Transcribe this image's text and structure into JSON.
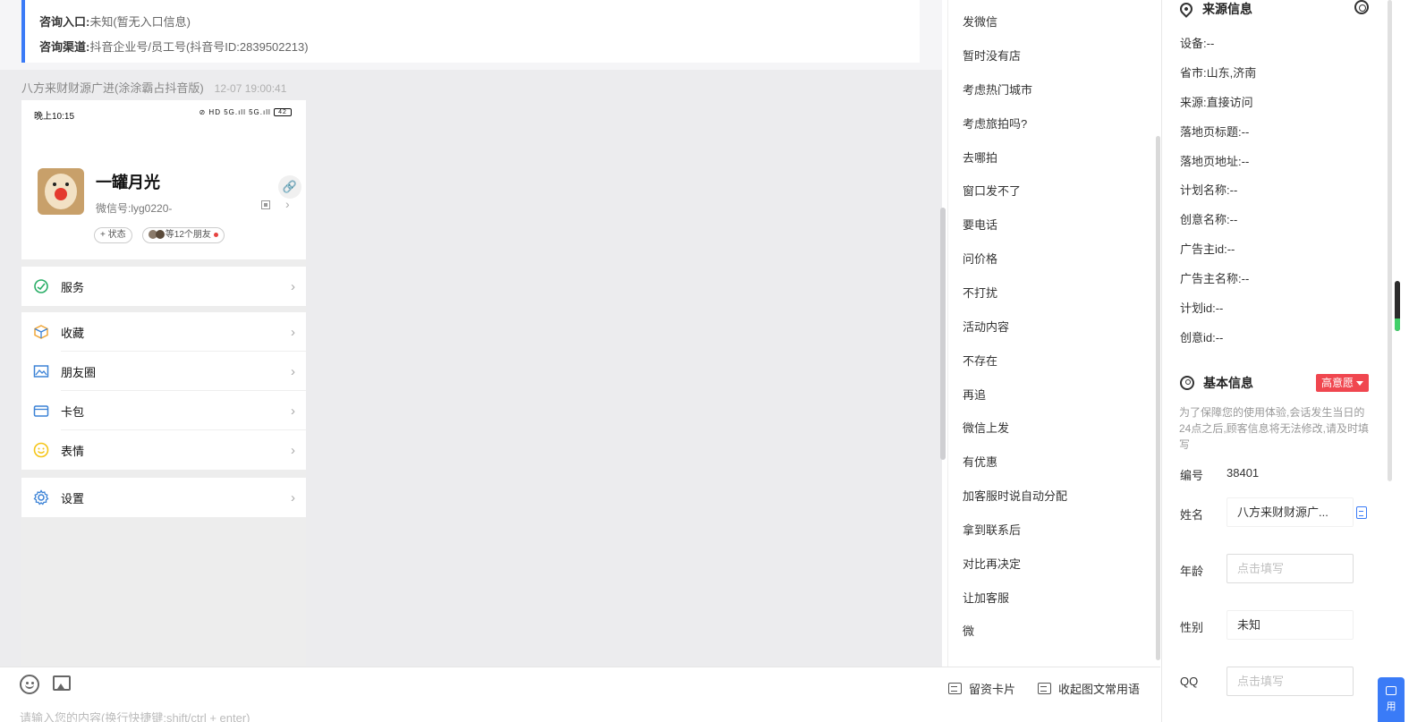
{
  "consult": {
    "entry_label": "咨询入口:",
    "entry_value": "未知(暂无入口信息)",
    "channel_label": "咨询渠道:",
    "channel_value": "抖音企业号/员工号(抖音号ID:2839502213)"
  },
  "message": {
    "sender": "八方来财财源广进(涂涂霸占抖音版)",
    "time": "12-07 19:00:41"
  },
  "phone_shot": {
    "status_time": "晚上10:15",
    "status_icons": "⊘ HD 5G.ıll 5G.ıll",
    "battery": "42",
    "nickname": "一罐月光",
    "wechat_id": "微信号:lyg0220-",
    "status_pill": "+ 状态",
    "friends_pill": "等12个朋友",
    "menu": [
      {
        "label": "服务",
        "icon": "service-icon",
        "color": "#2aae67"
      },
      {
        "label": "收藏",
        "icon": "cube-icon",
        "color": "#f0a73a"
      },
      {
        "label": "朋友圈",
        "icon": "moments-icon",
        "color": "#3b82d6"
      },
      {
        "label": "卡包",
        "icon": "card-icon",
        "color": "#3b82d6"
      },
      {
        "label": "表情",
        "icon": "emoji-icon",
        "color": "#f5c518"
      },
      {
        "label": "设置",
        "icon": "settings-icon",
        "color": "#3b82d6"
      }
    ]
  },
  "phrases": [
    "发微信",
    "暂时没有店",
    "考虑热门城市",
    "考虑旅拍吗?",
    "去哪拍",
    "窗口发不了",
    "要电话",
    "问价格",
    "不打扰",
    "活动内容",
    "不存在",
    "再追",
    "微信上发",
    "有优惠",
    "加客服时说自动分配",
    "拿到联系后",
    "对比再决定",
    "让加客服",
    "微"
  ],
  "input_bar": {
    "card_button": "留资卡片",
    "collapse_button": "收起图文常用语",
    "placeholder": "请输入您的内容(换行快捷键:shift/ctrl + enter)"
  },
  "source_info": {
    "title": "来源信息",
    "rows": [
      "设备:--",
      "省市:山东,济南",
      "来源:直接访问",
      "落地页标题:--",
      "落地页地址:--",
      "计划名称:--",
      "创意名称:--",
      "广告主id:--",
      "广告主名称:--",
      "计划id:--",
      "创意id:--"
    ]
  },
  "basic_info": {
    "title": "基本信息",
    "intent_tag": "高意愿",
    "intent_color": "#f0464f",
    "note": "为了保障您的使用体验,会话发生当日的24点之后,顾客信息将无法修改,请及时填写",
    "id_label": "编号",
    "id_value": "38401",
    "name_label": "姓名",
    "name_value": "八方来财财源广...",
    "age_label": "年龄",
    "age_placeholder": "点击填写",
    "gender_label": "性别",
    "gender_value": "未知",
    "qq_label": "QQ",
    "qq_placeholder": "点击填写"
  },
  "float_button": {
    "label": "用"
  },
  "accent_color": "#3a7bf7"
}
